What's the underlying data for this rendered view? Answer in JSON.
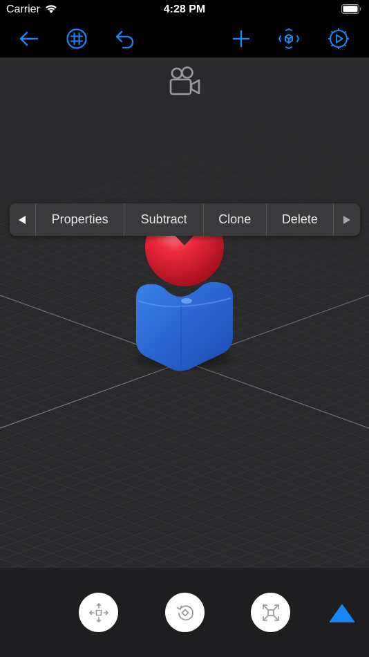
{
  "status_bar": {
    "carrier": "Carrier",
    "time": "4:28 PM"
  },
  "toolbar": {
    "icons": [
      "back-arrow-icon",
      "grid-icon",
      "undo-icon",
      "add-icon",
      "transform-icon",
      "settings-play-icon"
    ],
    "accent_color": "#1a86f5"
  },
  "context_menu": {
    "items": [
      "Properties",
      "Subtract",
      "Clone",
      "Delete"
    ]
  },
  "scene": {
    "objects": [
      "red-sphere",
      "blue-cube"
    ],
    "colors": {
      "sphere": "#e8283a",
      "cube": "#2a6de0",
      "grid_bg": "#2a2a2c"
    }
  },
  "bottom_bar": {
    "tools": [
      "move-icon",
      "rotate-icon",
      "scale-icon"
    ],
    "expand_icon": "triangle-up-icon"
  }
}
